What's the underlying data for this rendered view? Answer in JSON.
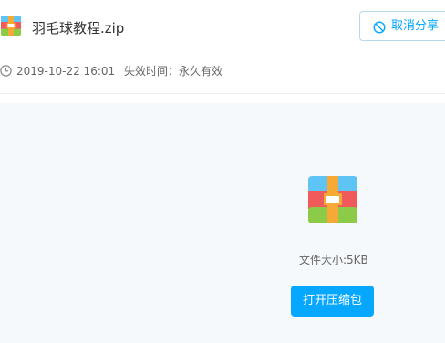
{
  "file": {
    "name": "羽毛球教程.zip",
    "icon": "zip-archive-icon"
  },
  "actions": {
    "cancel_share_label": "取消分享",
    "open_zip_label": "打开压缩包"
  },
  "meta": {
    "date": "2019-10-22 16:01",
    "expiry": "失效时间：永久有效",
    "file_size": "文件大小:5KB"
  },
  "colors": {
    "accent": "#06a7ff",
    "panel_background": "#f6f9fc",
    "zip_icon": [
      "#5ec4f5",
      "#f05a5a",
      "#8ccb48",
      "#f6a935"
    ]
  }
}
